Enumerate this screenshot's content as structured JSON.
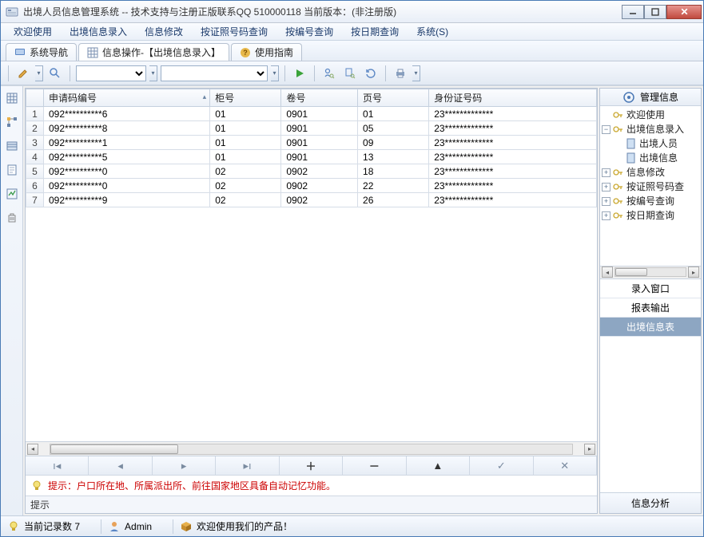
{
  "title": "出境人员信息管理系统 -- 技术支持与注册正版联系QQ 510000118    当前版本：(非注册版)",
  "menubar": [
    "欢迎使用",
    "出境信息录入",
    "信息修改",
    "按证照号码查询",
    "按编号查询",
    "按日期查询",
    "系统(S)"
  ],
  "tabs": {
    "nav": "系统导航",
    "op": "信息操作-【出境信息录入】",
    "guide": "使用指南"
  },
  "grid": {
    "columns": [
      "申请码编号",
      "柜号",
      "卷号",
      "页号",
      "身份证号码"
    ],
    "rows": [
      [
        "092**********6",
        "01",
        "0901",
        "01",
        "23*************"
      ],
      [
        "092**********8",
        "01",
        "0901",
        "05",
        "23*************"
      ],
      [
        "092**********1",
        "01",
        "0901",
        "09",
        "23*************"
      ],
      [
        "092**********5",
        "01",
        "0901",
        "13",
        "23*************"
      ],
      [
        "092**********0",
        "02",
        "0902",
        "18",
        "23*************"
      ],
      [
        "092**********0",
        "02",
        "0902",
        "22",
        "23*************"
      ],
      [
        "092**********9",
        "02",
        "0902",
        "26",
        "23*************"
      ]
    ]
  },
  "hint": "提示：户口所在地、所属派出所、前往国家地区具备自动记忆功能。",
  "hint_label": "提示",
  "right": {
    "header": "管理信息",
    "tree": {
      "n1": "欢迎使用",
      "n2": "出境信息录入",
      "n2a": "出境人员",
      "n2b": "出境信息",
      "n3": "信息修改",
      "n4": "按证照号码查",
      "n5": "按编号查询",
      "n6": "按日期查询"
    },
    "list": {
      "a": "录入窗口",
      "b": "报表输出",
      "c": "出境信息表"
    },
    "footer": "信息分析"
  },
  "status": {
    "records": "当前记录数 7",
    "user": "Admin",
    "welcome": "欢迎使用我们的产品！"
  }
}
